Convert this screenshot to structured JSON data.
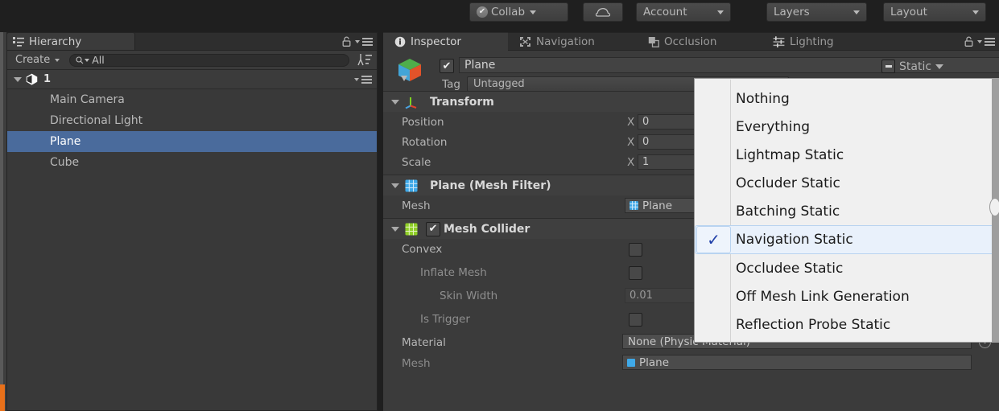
{
  "toolbar": {
    "collab": {
      "label": "Collab",
      "icon": "check-circle-icon"
    },
    "cloud": {
      "label": "",
      "icon": "cloud-icon"
    },
    "account": {
      "label": "Account"
    },
    "layers": {
      "label": "Layers"
    },
    "layout": {
      "label": "Layout"
    }
  },
  "hierarchy": {
    "tab_label": "Hierarchy",
    "tab_icon": "hierarchy-icon",
    "create_label": "Create",
    "search_value": "All",
    "scene_name": "1",
    "items": [
      {
        "label": "Main Camera",
        "selected": false
      },
      {
        "label": "Directional Light",
        "selected": false
      },
      {
        "label": "Plane",
        "selected": true
      },
      {
        "label": "Cube",
        "selected": false
      }
    ]
  },
  "inspector": {
    "tabs": [
      {
        "label": "Inspector",
        "icon": "info-icon",
        "active": true
      },
      {
        "label": "Navigation",
        "icon": "navmesh-icon",
        "active": false
      },
      {
        "label": "Occlusion",
        "icon": "occlusion-icon",
        "active": false
      },
      {
        "label": "Lighting",
        "icon": "lighting-icon",
        "active": false
      }
    ],
    "object": {
      "icon": "cube-icon",
      "enabled_checkmark": "✔",
      "name": "Plane",
      "tag_label": "Tag",
      "tag_value": "Untagged",
      "static_label": "Static",
      "static_state": "mixed"
    },
    "transform": {
      "title": "Transform",
      "icon": "transform-axes-icon",
      "rows": [
        {
          "label": "Position",
          "axis": "X",
          "value": "0"
        },
        {
          "label": "Rotation",
          "axis": "X",
          "value": "0"
        },
        {
          "label": "Scale",
          "axis": "X",
          "value": "1"
        }
      ]
    },
    "mesh_filter": {
      "title": "Plane (Mesh Filter)",
      "icon": "mesh-filter-icon",
      "mesh_label": "Mesh",
      "mesh_value": "Plane"
    },
    "mesh_collider": {
      "title": "Mesh Collider",
      "icon": "mesh-collider-icon",
      "enabled_checkmark": "✔",
      "convex_label": "Convex",
      "inflate_label": "Inflate Mesh",
      "skin_label": "Skin Width",
      "skin_value": "0.01",
      "trigger_label": "Is Trigger",
      "material_label": "Material",
      "material_value": "None (Physic Material)",
      "mesh_label": "Mesh"
    }
  },
  "static_dropdown": {
    "items": [
      {
        "label": "Nothing",
        "checked": false,
        "highlighted": false
      },
      {
        "label": "Everything",
        "checked": false,
        "highlighted": false
      },
      {
        "label": "Lightmap Static",
        "checked": false,
        "highlighted": false
      },
      {
        "label": "Occluder Static",
        "checked": false,
        "highlighted": false
      },
      {
        "label": "Batching Static",
        "checked": false,
        "highlighted": false
      },
      {
        "label": "Navigation Static",
        "checked": true,
        "highlighted": true
      },
      {
        "label": "Occludee Static",
        "checked": false,
        "highlighted": false
      },
      {
        "label": "Off Mesh Link Generation",
        "checked": false,
        "highlighted": false
      },
      {
        "label": "Reflection Probe Static",
        "checked": false,
        "highlighted": false
      }
    ],
    "checkmark": "✓"
  },
  "colors": {
    "selection_blue": "#4a6b9c",
    "menu_highlight": "#e9f1fb",
    "accent_orange": "#e8701a",
    "panel_bg": "#383838"
  }
}
